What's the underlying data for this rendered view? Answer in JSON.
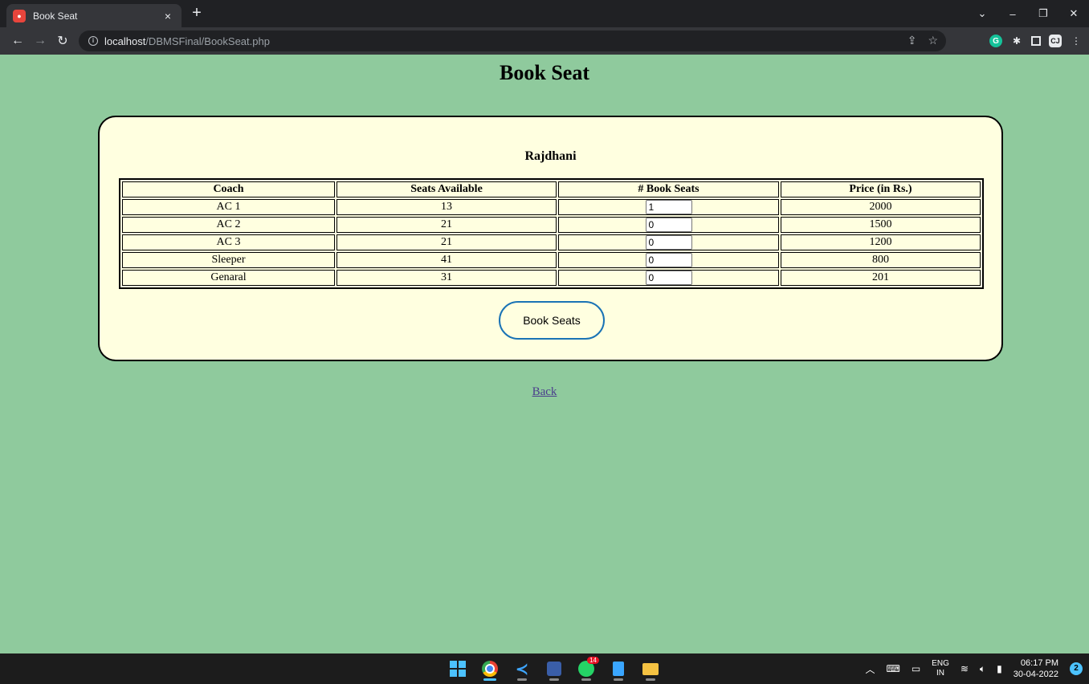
{
  "browser": {
    "tab_title": "Book Seat",
    "tab_close": "×",
    "new_tab": "+",
    "url_host": "localhost",
    "url_path": "/DBMSFinal/BookSeat.php",
    "window_controls": [
      "⌄",
      "–",
      "❐",
      "✕"
    ]
  },
  "page": {
    "title": "Book Seat",
    "train_name": "Rajdhani",
    "table": {
      "headers": [
        "Coach",
        "Seats Available",
        "# Book Seats",
        "Price (in Rs.)"
      ],
      "rows": [
        {
          "coach": "AC 1",
          "available": "13",
          "book": "1",
          "price": "2000"
        },
        {
          "coach": "AC 2",
          "available": "21",
          "book": "0",
          "price": "1500"
        },
        {
          "coach": "AC 3",
          "available": "21",
          "book": "0",
          "price": "1200"
        },
        {
          "coach": "Sleeper",
          "available": "41",
          "book": "0",
          "price": "800"
        },
        {
          "coach": "Genaral",
          "available": "31",
          "book": "0",
          "price": "201"
        }
      ]
    },
    "book_button": "Book Seats",
    "back_link": "Back"
  },
  "taskbar": {
    "whatsapp_badge": "14",
    "lang_top": "ENG",
    "lang_bottom": "IN",
    "time": "06:17 PM",
    "date": "30-04-2022",
    "notification_count": "2"
  },
  "colors": {
    "page_background": "#8fca9d",
    "card_background": "#ffffe0",
    "button_border": "#1a73b5"
  }
}
